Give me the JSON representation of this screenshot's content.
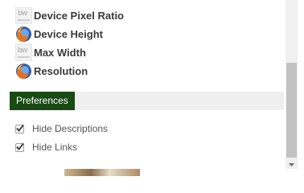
{
  "features": [
    {
      "label": "Device Pixel Ratio",
      "icon": "bw-icon"
    },
    {
      "label": "Device Height",
      "icon": "firefox-icon"
    },
    {
      "label": "Max Width",
      "icon": "bw-icon"
    },
    {
      "label": "Resolution",
      "icon": "firefox-icon"
    }
  ],
  "preferences": {
    "title": "Preferences",
    "options": [
      {
        "label": "Hide Descriptions",
        "checked": true
      },
      {
        "label": "Hide Links",
        "checked": true
      }
    ]
  },
  "colors": {
    "preferences_tab": "#1a4a14",
    "scrollbar_thumb": "#c2c2c2",
    "firefox_orange": "#e8721c",
    "firefox_blue": "#2a5db0"
  }
}
